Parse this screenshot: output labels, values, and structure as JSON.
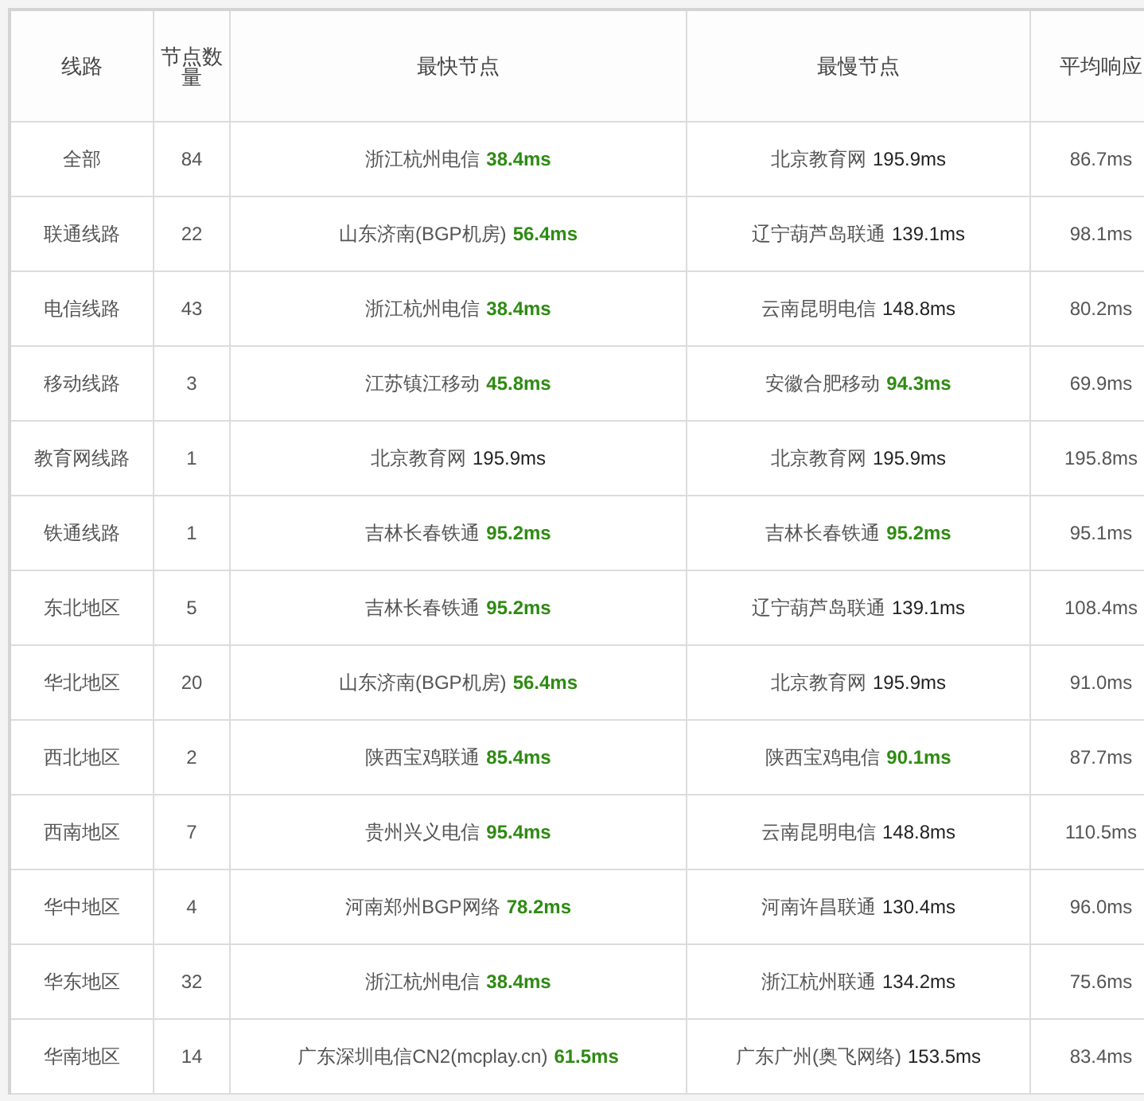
{
  "table": {
    "columns": [
      "线路",
      "节点数量",
      "最快节点",
      "最慢节点",
      "平均响应"
    ],
    "rows": [
      {
        "line": "全部",
        "count": "84",
        "fastest": {
          "node": "浙江杭州电信",
          "latency": "38.4ms",
          "kind": "good"
        },
        "slowest": {
          "node": "北京教育网",
          "latency": "195.9ms",
          "kind": "plain"
        },
        "average": "86.7ms"
      },
      {
        "line": "联通线路",
        "count": "22",
        "fastest": {
          "node": "山东济南(BGP机房)",
          "latency": "56.4ms",
          "kind": "good"
        },
        "slowest": {
          "node": "辽宁葫芦岛联通",
          "latency": "139.1ms",
          "kind": "plain"
        },
        "average": "98.1ms"
      },
      {
        "line": "电信线路",
        "count": "43",
        "fastest": {
          "node": "浙江杭州电信",
          "latency": "38.4ms",
          "kind": "good"
        },
        "slowest": {
          "node": "云南昆明电信",
          "latency": "148.8ms",
          "kind": "plain"
        },
        "average": "80.2ms"
      },
      {
        "line": "移动线路",
        "count": "3",
        "fastest": {
          "node": "江苏镇江移动",
          "latency": "45.8ms",
          "kind": "good"
        },
        "slowest": {
          "node": "安徽合肥移动",
          "latency": "94.3ms",
          "kind": "good"
        },
        "average": "69.9ms"
      },
      {
        "line": "教育网线路",
        "count": "1",
        "fastest": {
          "node": "北京教育网",
          "latency": "195.9ms",
          "kind": "plain"
        },
        "slowest": {
          "node": "北京教育网",
          "latency": "195.9ms",
          "kind": "plain"
        },
        "average": "195.8ms"
      },
      {
        "line": "铁通线路",
        "count": "1",
        "fastest": {
          "node": "吉林长春铁通",
          "latency": "95.2ms",
          "kind": "good"
        },
        "slowest": {
          "node": "吉林长春铁通",
          "latency": "95.2ms",
          "kind": "good"
        },
        "average": "95.1ms"
      },
      {
        "line": "东北地区",
        "count": "5",
        "fastest": {
          "node": "吉林长春铁通",
          "latency": "95.2ms",
          "kind": "good"
        },
        "slowest": {
          "node": "辽宁葫芦岛联通",
          "latency": "139.1ms",
          "kind": "plain"
        },
        "average": "108.4ms"
      },
      {
        "line": "华北地区",
        "count": "20",
        "fastest": {
          "node": "山东济南(BGP机房)",
          "latency": "56.4ms",
          "kind": "good"
        },
        "slowest": {
          "node": "北京教育网",
          "latency": "195.9ms",
          "kind": "plain"
        },
        "average": "91.0ms"
      },
      {
        "line": "西北地区",
        "count": "2",
        "fastest": {
          "node": "陕西宝鸡联通",
          "latency": "85.4ms",
          "kind": "good"
        },
        "slowest": {
          "node": "陕西宝鸡电信",
          "latency": "90.1ms",
          "kind": "good"
        },
        "average": "87.7ms"
      },
      {
        "line": "西南地区",
        "count": "7",
        "fastest": {
          "node": "贵州兴义电信",
          "latency": "95.4ms",
          "kind": "good"
        },
        "slowest": {
          "node": "云南昆明电信",
          "latency": "148.8ms",
          "kind": "plain"
        },
        "average": "110.5ms"
      },
      {
        "line": "华中地区",
        "count": "4",
        "fastest": {
          "node": "河南郑州BGP网络",
          "latency": "78.2ms",
          "kind": "good"
        },
        "slowest": {
          "node": "河南许昌联通",
          "latency": "130.4ms",
          "kind": "plain"
        },
        "average": "96.0ms"
      },
      {
        "line": "华东地区",
        "count": "32",
        "fastest": {
          "node": "浙江杭州电信",
          "latency": "38.4ms",
          "kind": "good"
        },
        "slowest": {
          "node": "浙江杭州联通",
          "latency": "134.2ms",
          "kind": "plain"
        },
        "average": "75.6ms"
      },
      {
        "line": "华南地区",
        "count": "14",
        "fastest": {
          "node": "广东深圳电信CN2(mcplay.cn)",
          "latency": "61.5ms",
          "kind": "good"
        },
        "slowest": {
          "node": "广东广州(奥飞网络)",
          "latency": "153.5ms",
          "kind": "plain"
        },
        "average": "83.4ms"
      }
    ]
  }
}
